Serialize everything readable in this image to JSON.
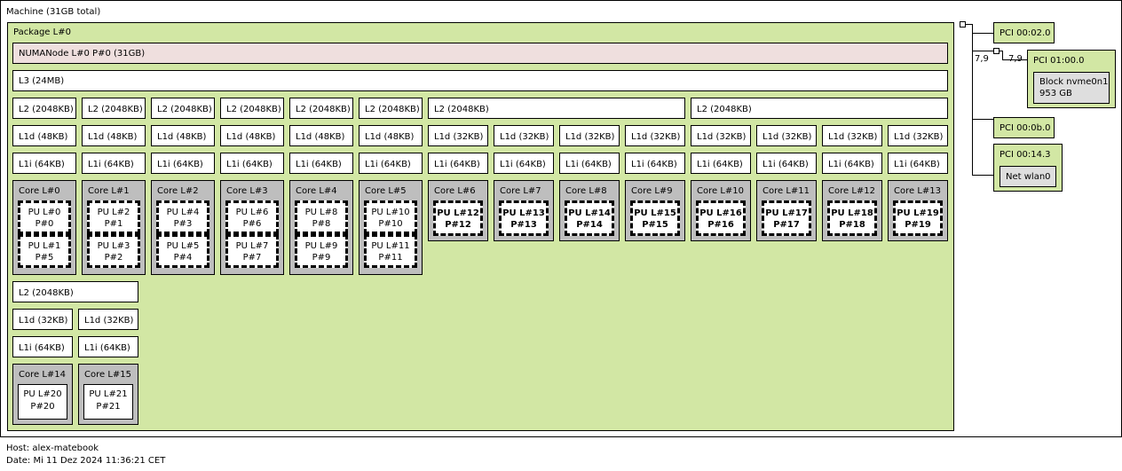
{
  "machine": {
    "label": "Machine (31GB total)"
  },
  "package": {
    "label": "Package L#0"
  },
  "numa": {
    "label": "NUMANode L#0 P#0 (31GB)"
  },
  "l3": {
    "label": "L3 (24MB)"
  },
  "l2": [
    "L2 (2048KB)",
    "L2 (2048KB)",
    "L2 (2048KB)",
    "L2 (2048KB)",
    "L2 (2048KB)",
    "L2 (2048KB)",
    "L2 (2048KB)",
    "L2 (2048KB)",
    "L2 (2048KB)"
  ],
  "l1d": [
    "L1d (48KB)",
    "L1d (48KB)",
    "L1d (48KB)",
    "L1d (48KB)",
    "L1d (48KB)",
    "L1d (48KB)",
    "L1d (32KB)",
    "L1d (32KB)",
    "L1d (32KB)",
    "L1d (32KB)",
    "L1d (32KB)",
    "L1d (32KB)",
    "L1d (32KB)",
    "L1d (32KB)",
    "L1d (32KB)",
    "L1d (32KB)"
  ],
  "l1i": [
    "L1i (64KB)",
    "L1i (64KB)",
    "L1i (64KB)",
    "L1i (64KB)",
    "L1i (64KB)",
    "L1i (64KB)",
    "L1i (64KB)",
    "L1i (64KB)",
    "L1i (64KB)",
    "L1i (64KB)",
    "L1i (64KB)",
    "L1i (64KB)",
    "L1i (64KB)",
    "L1i (64KB)",
    "L1i (64KB)",
    "L1i (64KB)"
  ],
  "cores": [
    {
      "label": "Core L#0",
      "pus": [
        {
          "l1": "PU L#0",
          "l2": "P#0"
        },
        {
          "l1": "PU L#1",
          "l2": "P#5"
        }
      ]
    },
    {
      "label": "Core L#1",
      "pus": [
        {
          "l1": "PU L#2",
          "l2": "P#1"
        },
        {
          "l1": "PU L#3",
          "l2": "P#2"
        }
      ]
    },
    {
      "label": "Core L#2",
      "pus": [
        {
          "l1": "PU L#4",
          "l2": "P#3"
        },
        {
          "l1": "PU L#5",
          "l2": "P#4"
        }
      ]
    },
    {
      "label": "Core L#3",
      "pus": [
        {
          "l1": "PU L#6",
          "l2": "P#6"
        },
        {
          "l1": "PU L#7",
          "l2": "P#7"
        }
      ]
    },
    {
      "label": "Core L#4",
      "pus": [
        {
          "l1": "PU L#8",
          "l2": "P#8"
        },
        {
          "l1": "PU L#9",
          "l2": "P#9"
        }
      ]
    },
    {
      "label": "Core L#5",
      "pus": [
        {
          "l1": "PU L#10",
          "l2": "P#10"
        },
        {
          "l1": "PU L#11",
          "l2": "P#11"
        }
      ]
    },
    {
      "label": "Core L#6",
      "pus": [
        {
          "l1": "PU L#12",
          "l2": "P#12"
        }
      ]
    },
    {
      "label": "Core L#7",
      "pus": [
        {
          "l1": "PU L#13",
          "l2": "P#13"
        }
      ]
    },
    {
      "label": "Core L#8",
      "pus": [
        {
          "l1": "PU L#14",
          "l2": "P#14"
        }
      ]
    },
    {
      "label": "Core L#9",
      "pus": [
        {
          "l1": "PU L#15",
          "l2": "P#15"
        }
      ]
    },
    {
      "label": "Core L#10",
      "pus": [
        {
          "l1": "PU L#16",
          "l2": "P#16"
        }
      ]
    },
    {
      "label": "Core L#11",
      "pus": [
        {
          "l1": "PU L#17",
          "l2": "P#17"
        }
      ]
    },
    {
      "label": "Core L#12",
      "pus": [
        {
          "l1": "PU L#18",
          "l2": "P#18"
        }
      ]
    },
    {
      "label": "Core L#13",
      "pus": [
        {
          "l1": "PU L#19",
          "l2": "P#19"
        }
      ]
    },
    {
      "label": "Core L#14",
      "pus": [
        {
          "l1": "PU L#20",
          "l2": "P#20"
        }
      ]
    },
    {
      "label": "Core L#15",
      "pus": [
        {
          "l1": "PU L#21",
          "l2": "P#21"
        }
      ]
    }
  ],
  "pci": {
    "p1": "PCI 00:02.0",
    "p2": "PCI 01:00.0",
    "p2_dev1": "Block nvme0n1",
    "p2_dev2": "953 GB",
    "p3": "PCI 00:0b.0",
    "p4": "PCI 00:14.3",
    "p4_dev": "Net wlan0",
    "link1": "7,9",
    "link2": "7,9"
  },
  "footer": {
    "host": "Host: alex-matebook",
    "date": "Date: Mi 11 Dez 2024 11:36:21 CET"
  },
  "colors": {
    "package": "#d2e7a4",
    "numa": "#efdfde",
    "core": "#bebebe",
    "pci": "#d2e7a4",
    "device": "#dedede"
  }
}
